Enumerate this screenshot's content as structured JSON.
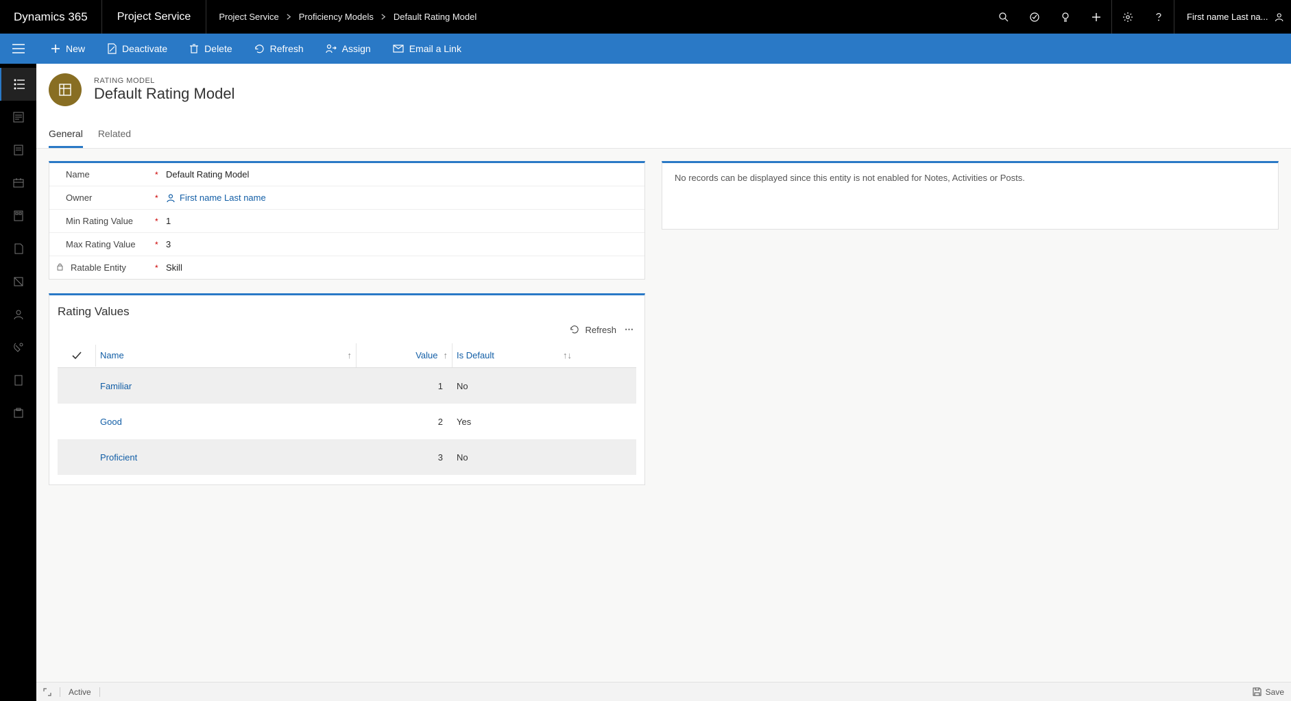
{
  "topbar": {
    "brand": "Dynamics 365",
    "module": "Project Service",
    "breadcrumbs": [
      "Project Service",
      "Proficiency Models",
      "Default Rating Model"
    ],
    "user_display": "First name Last na..."
  },
  "commands": {
    "new": "New",
    "deactivate": "Deactivate",
    "delete": "Delete",
    "refresh": "Refresh",
    "assign": "Assign",
    "email": "Email a Link"
  },
  "record": {
    "kicker": "RATING MODEL",
    "title": "Default Rating Model"
  },
  "tabs": {
    "general": "General",
    "related": "Related"
  },
  "form": {
    "labels": {
      "name": "Name",
      "owner": "Owner",
      "min": "Min Rating Value",
      "max": "Max Rating Value",
      "ratable": "Ratable Entity"
    },
    "values": {
      "name": "Default Rating Model",
      "owner": "First name Last name",
      "min": "1",
      "max": "3",
      "ratable": "Skill"
    }
  },
  "side_panel": {
    "message": "No records can be displayed since this entity is not enabled for Notes, Activities or Posts."
  },
  "rating_values": {
    "title": "Rating Values",
    "actions": {
      "refresh": "Refresh"
    },
    "columns": {
      "name": "Name",
      "value": "Value",
      "is_default": "Is Default"
    },
    "rows": [
      {
        "name": "Familiar",
        "value": "1",
        "is_default": "No"
      },
      {
        "name": "Good",
        "value": "2",
        "is_default": "Yes"
      },
      {
        "name": "Proficient",
        "value": "3",
        "is_default": "No"
      }
    ]
  },
  "statusbar": {
    "state": "Active",
    "save": "Save"
  }
}
